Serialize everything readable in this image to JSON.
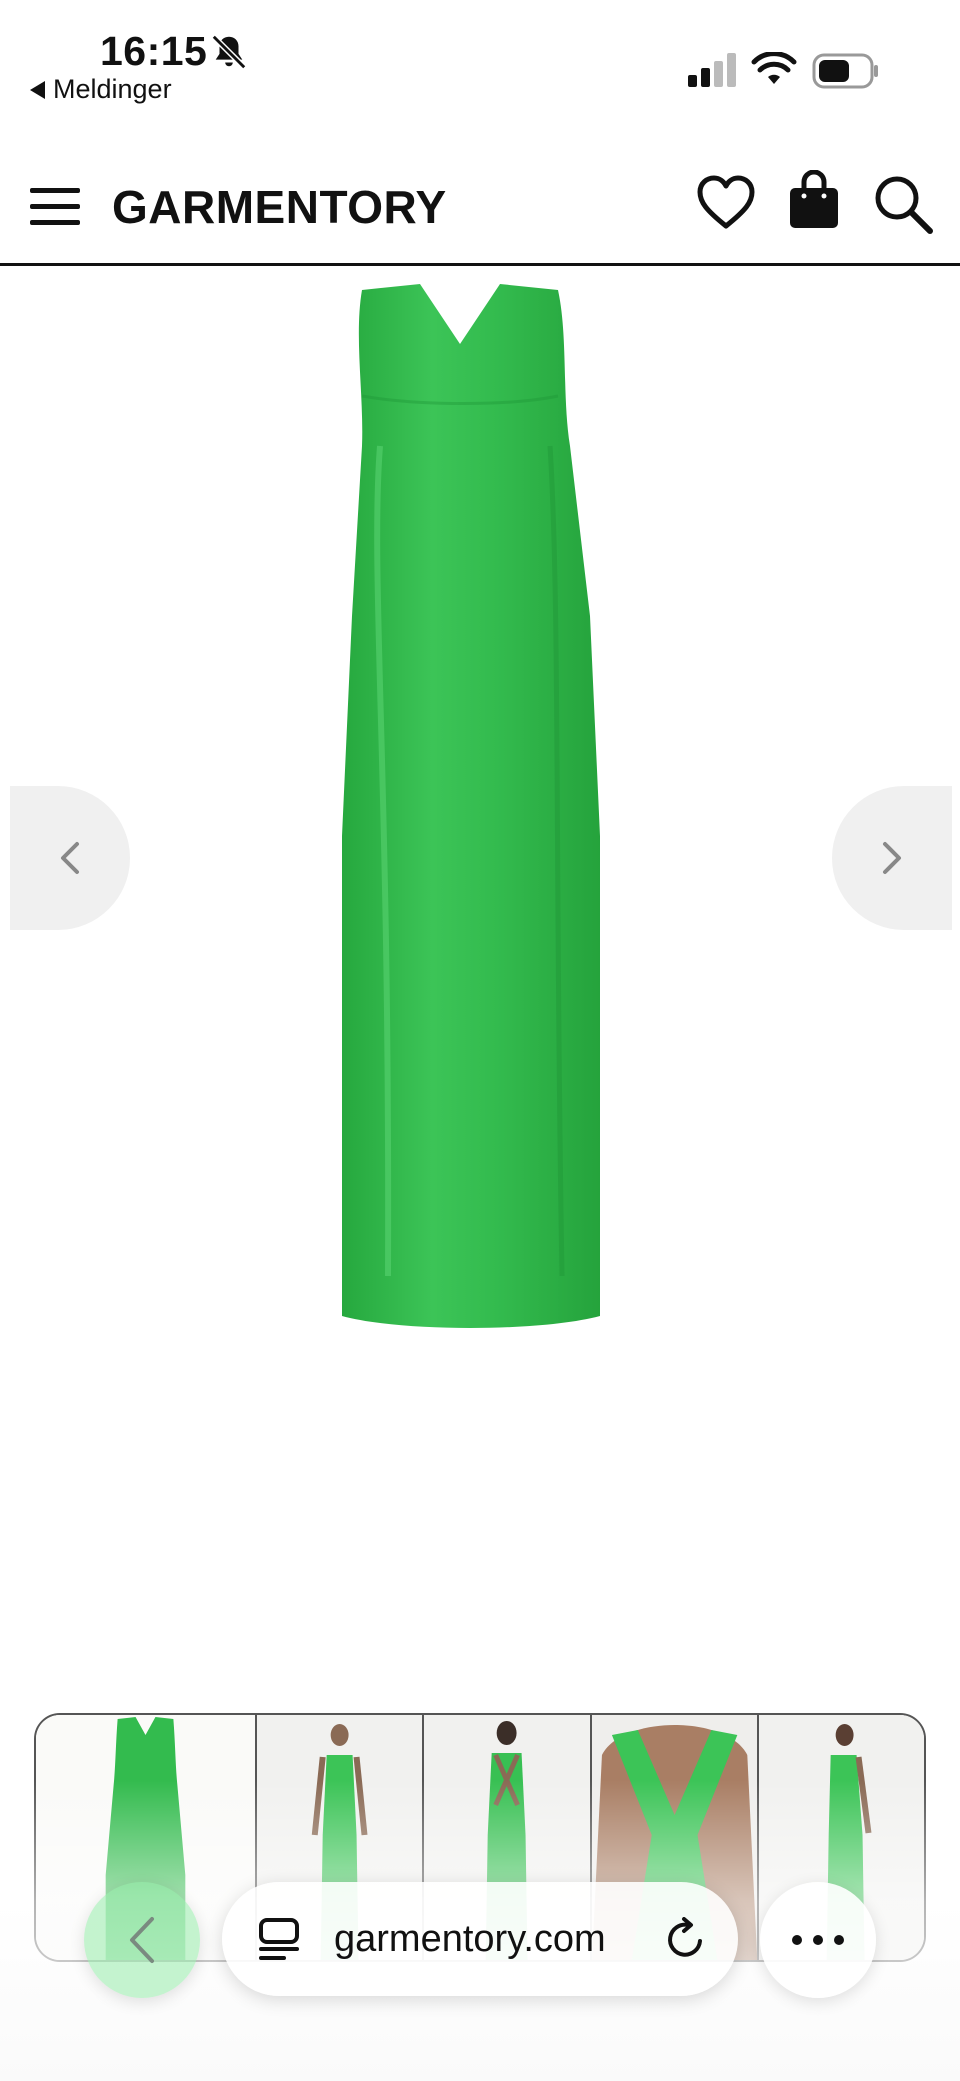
{
  "status_bar": {
    "time": "16:15",
    "back_app": "Meldinger",
    "icons": [
      "bell-slash-icon",
      "signal-icon",
      "wifi-icon",
      "battery-icon"
    ]
  },
  "header": {
    "logo": "GARMENTORY",
    "icons": [
      "menu-icon",
      "heart-icon",
      "bag-icon",
      "search-icon"
    ]
  },
  "gallery": {
    "main_image": "green-dress-image",
    "prev_icon": "chevron-left-icon",
    "next_icon": "chevron-right-icon",
    "thumbnails": [
      "dress-front",
      "model-front",
      "model-back",
      "back-detail",
      "model-side"
    ],
    "dress_color": "#2eb84b"
  },
  "browser": {
    "url": "garmentory.com",
    "icons": [
      "back-icon",
      "tabs-icon",
      "reload-icon",
      "more-icon"
    ]
  }
}
